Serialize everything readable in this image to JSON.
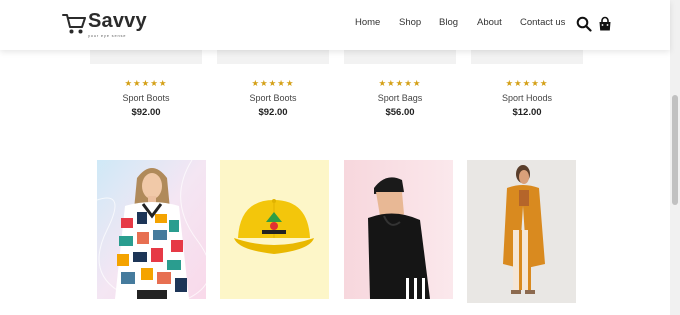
{
  "brand": {
    "name": "Savvy",
    "tagline": "your eye sense"
  },
  "nav": {
    "items": [
      "Home",
      "Shop",
      "Blog",
      "About",
      "Contact us"
    ]
  },
  "icons": {
    "logo": "shopping-cart-icon",
    "search": "search-icon",
    "cart": "shopping-bag-icon"
  },
  "products": [
    {
      "name": "Sport Boots",
      "price": "$92.00",
      "rating": "★★★★★"
    },
    {
      "name": "Sport Boots",
      "price": "$92.00",
      "rating": "★★★★★"
    },
    {
      "name": "Sport Bags",
      "price": "$56.00",
      "rating": "★★★★★"
    },
    {
      "name": "Sport Hoods",
      "price": "$12.00",
      "rating": "★★★★★"
    }
  ],
  "colors": {
    "star": "#d4a017",
    "text": "#222222"
  }
}
